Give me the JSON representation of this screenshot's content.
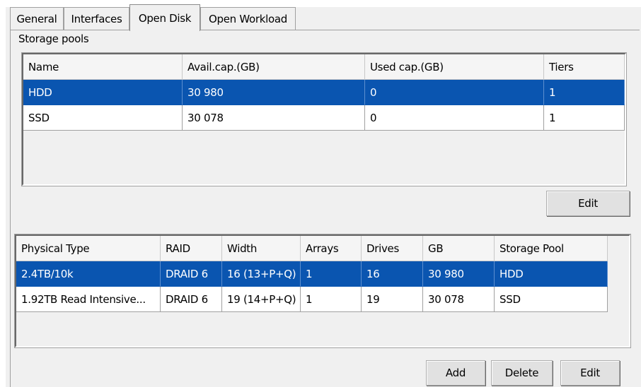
{
  "tabs": [
    {
      "label": "General"
    },
    {
      "label": "Interfaces"
    },
    {
      "label": "Open Disk"
    },
    {
      "label": "Open Workload"
    }
  ],
  "storage_pools": {
    "group_label": "Storage pools",
    "columns": [
      "Name",
      "Avail.cap.(GB)",
      "Used cap.(GB)",
      "Tiers"
    ],
    "rows": [
      {
        "cells": [
          "HDD",
          "30 980",
          "0",
          "1"
        ],
        "selected": true
      },
      {
        "cells": [
          "SSD",
          "30 078",
          "0",
          "1"
        ],
        "selected": false
      }
    ],
    "edit_label": "Edit"
  },
  "arrays": {
    "columns": [
      "Physical Type",
      "RAID",
      "Width",
      "Arrays",
      "Drives",
      "GB",
      "Storage Pool"
    ],
    "rows": [
      {
        "cells": [
          "2.4TB/10k",
          "DRAID 6",
          "16 (13+P+Q)",
          "1",
          "16",
          "30 980",
          "HDD"
        ],
        "selected": true
      },
      {
        "cells": [
          "1.92TB Read Intensive...",
          "DRAID 6",
          "19 (14+P+Q)",
          "1",
          "19",
          "30 078",
          "SSD"
        ],
        "selected": false
      }
    ],
    "add_label": "Add",
    "delete_label": "Delete",
    "edit_label": "Edit"
  },
  "colors": {
    "selection": "#0a55b0",
    "panel": "#f0f0f0"
  }
}
